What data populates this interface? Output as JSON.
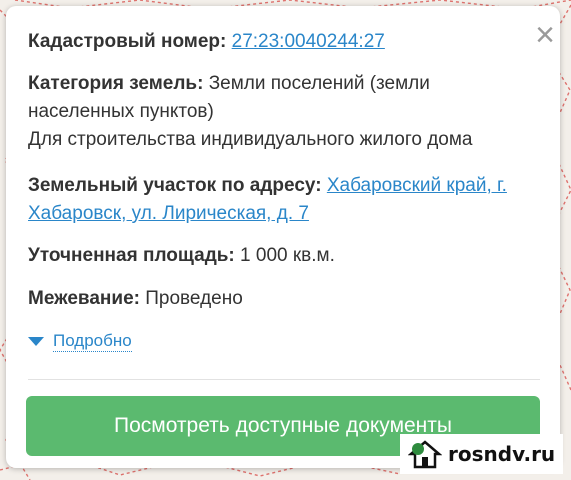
{
  "popup": {
    "close_icon": "×",
    "cadastral": {
      "label": "Кадастровый номер:",
      "value": "27:23:0040244:27"
    },
    "category": {
      "label": "Категория земель:",
      "value": "Земли поселений (земли населенных пунктов)",
      "use": "Для строительства индивидуального жилого дома"
    },
    "address": {
      "label": "Земельный участок по адресу:",
      "value": "Хабаровский край, г. Хабаровск, ул. Лирическая, д. 7"
    },
    "area": {
      "label": "Уточненная площадь:",
      "value": "1 000 кв.м."
    },
    "survey": {
      "label": "Межевание:",
      "value": "Проведено"
    },
    "details_link": "Подробно",
    "cta_button": "Посмотреть доступные документы"
  },
  "watermark": {
    "text": "rosndv.ru",
    "icon": "house-icon"
  },
  "colors": {
    "link": "#2a86c9",
    "button": "#5bba6f",
    "map_lines": "#d9534f"
  }
}
